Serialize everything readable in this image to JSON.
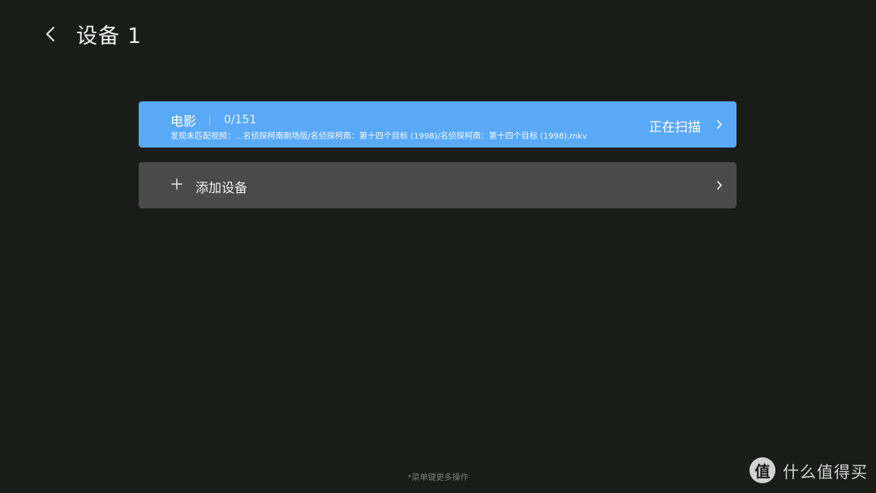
{
  "header": {
    "back_icon": "chevron-left-icon",
    "title": "设备 1"
  },
  "media_card": {
    "name": "电影",
    "count": "0/151",
    "detail": "发现未匹配视频：...名侦探柯南剧场版/名侦探柯南：第十四个目标 (1998)/名侦探柯南：第十四个目标 (1998).mkv",
    "status": "正在扫描",
    "color": "#5aa9f7",
    "arrow_icon": "chevron-right-icon"
  },
  "add_card": {
    "icon": "plus-icon",
    "label": "添加设备",
    "color": "#4a4a4a",
    "arrow_icon": "chevron-right-icon"
  },
  "footer": {
    "hint": "*菜单键更多操作"
  },
  "watermark": {
    "logo_char": "值",
    "text": "什么值得买"
  }
}
